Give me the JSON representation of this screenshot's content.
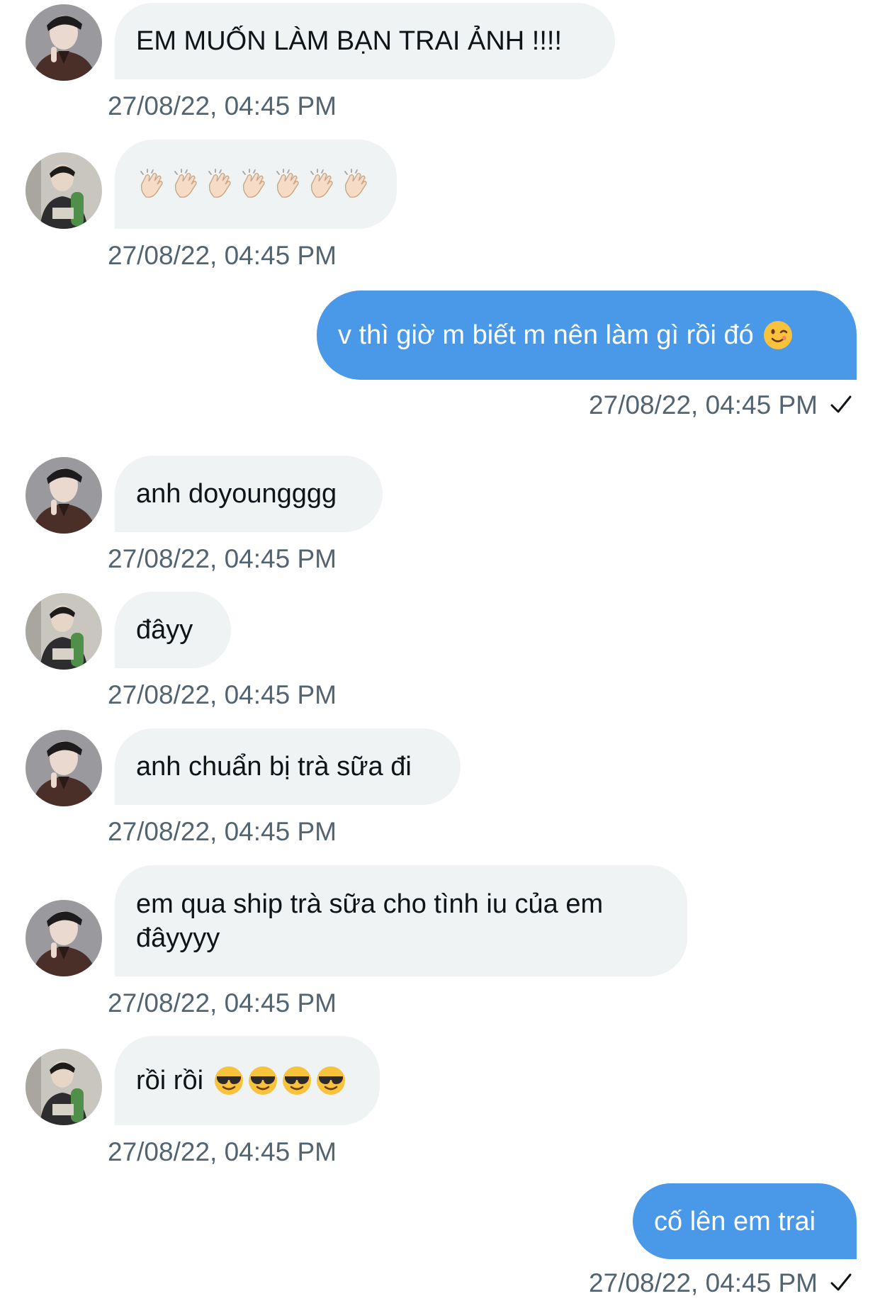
{
  "messages": [
    {
      "sender": "them",
      "avatar": "avatar-dark-jacket",
      "text": "EM MUỐN LÀM BẠN TRAI ẢNH !!!!",
      "timestamp": "27/08/22, 04:45 PM"
    },
    {
      "sender": "them",
      "avatar": "avatar-green-sleeve",
      "text": "",
      "emoji": "clapping-hands-light-skin-tone",
      "emoji_count": 7,
      "timestamp": "27/08/22, 04:45 PM"
    },
    {
      "sender": "me",
      "text": "v thì giờ m biết m nên làm gì rồi đó",
      "emoji": "winking-face",
      "timestamp": "27/08/22, 04:45 PM",
      "status": "sent"
    },
    {
      "sender": "them",
      "avatar": "avatar-dark-jacket",
      "text": "anh doyoungggg",
      "timestamp": "27/08/22, 04:45 PM"
    },
    {
      "sender": "them",
      "avatar": "avatar-green-sleeve",
      "text": "đâyy",
      "timestamp": "27/08/22, 04:45 PM"
    },
    {
      "sender": "them",
      "avatar": "avatar-dark-jacket",
      "text": "anh chuẩn bị trà sữa đi",
      "timestamp": "27/08/22, 04:45 PM"
    },
    {
      "sender": "them",
      "avatar": "avatar-dark-jacket",
      "text": "em qua ship trà sữa cho tình iu của em đâyyyy",
      "timestamp": "27/08/22, 04:45 PM"
    },
    {
      "sender": "them",
      "avatar": "avatar-green-sleeve",
      "text": "rồi rồi",
      "emoji": "smiling-face-with-sunglasses",
      "emoji_count": 4,
      "timestamp": "27/08/22, 04:45 PM"
    },
    {
      "sender": "me",
      "text": "cố lên em trai",
      "timestamp": "27/08/22, 04:45 PM",
      "status": "sent"
    }
  ],
  "colors": {
    "outgoing_bubble": "#4a99e9",
    "incoming_bubble": "#eff3f4",
    "timestamp_text": "#536471",
    "message_text": "#0f1419"
  }
}
